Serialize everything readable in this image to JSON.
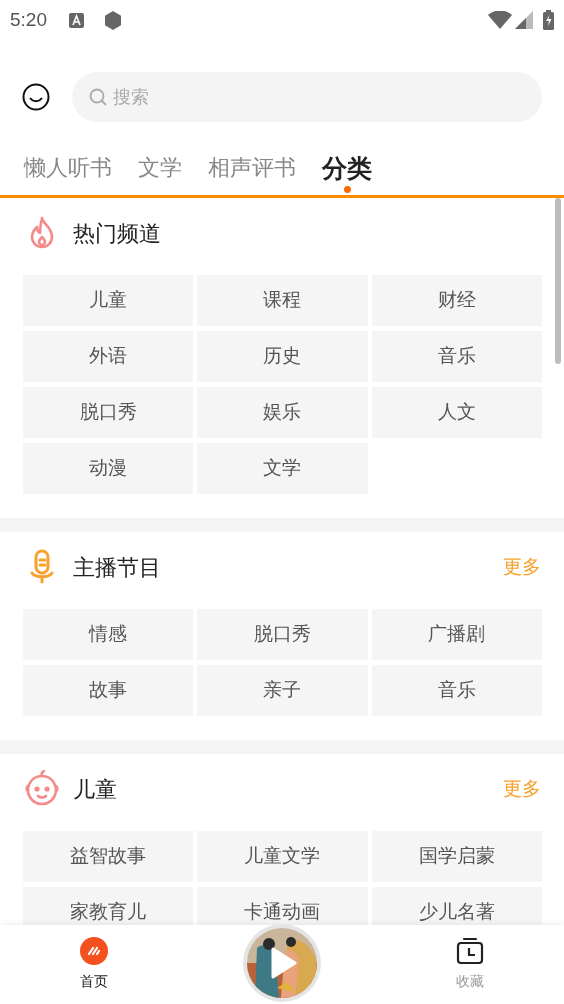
{
  "status_bar": {
    "time": "5:20"
  },
  "search": {
    "placeholder": "搜索"
  },
  "tabs": [
    {
      "label": "懒人听书",
      "selected": false
    },
    {
      "label": "文学",
      "selected": false
    },
    {
      "label": "相声评书",
      "selected": false
    },
    {
      "label": "分类",
      "selected": true
    }
  ],
  "sections": [
    {
      "kind": "fire",
      "title": "热门频道",
      "items": [
        "儿童",
        "课程",
        "财经",
        "外语",
        "历史",
        "音乐",
        "脱口秀",
        "娱乐",
        "人文",
        "动漫",
        "文学"
      ]
    },
    {
      "kind": "mic",
      "title": "主播节目",
      "more": "更多",
      "items": [
        "情感",
        "脱口秀",
        "广播剧",
        "故事",
        "亲子",
        "音乐"
      ]
    },
    {
      "kind": "baby",
      "title": "儿童",
      "more": "更多",
      "items": [
        "益智故事",
        "儿童文学",
        "国学启蒙",
        "家教育儿",
        "卡通动画",
        "少儿名著"
      ]
    }
  ],
  "bottom_nav": [
    {
      "kind": "home",
      "label": "首页",
      "selected": true
    },
    {
      "kind": "player"
    },
    {
      "kind": "favorites",
      "label": "收藏",
      "selected": false
    }
  ]
}
